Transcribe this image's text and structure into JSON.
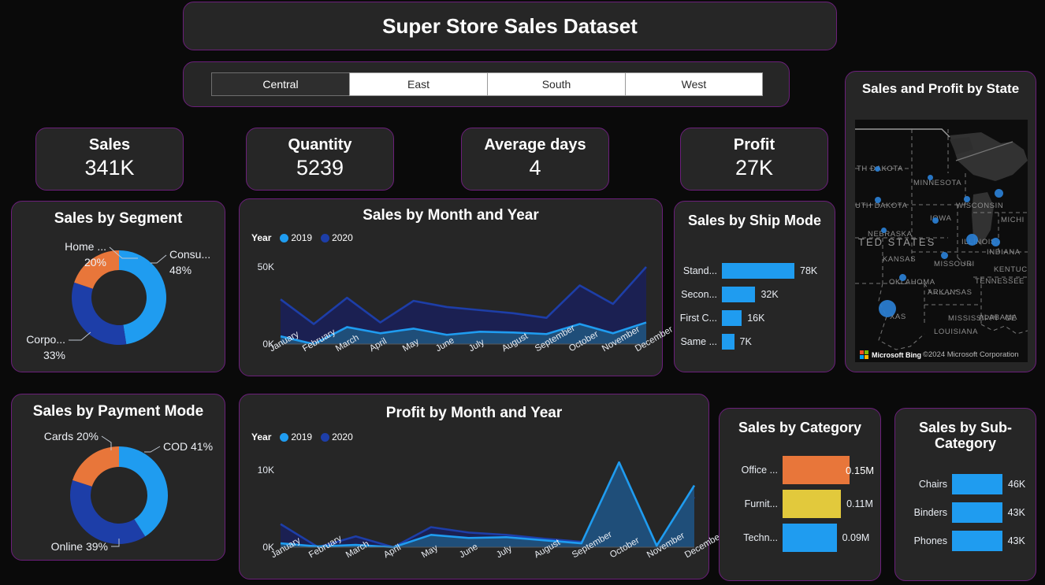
{
  "header": {
    "title": "Super Store Sales Dataset"
  },
  "slicer": {
    "name": "region-slicer",
    "options": [
      "Central",
      "East",
      "South",
      "West"
    ],
    "selected": "Central"
  },
  "kpis": [
    {
      "label": "Sales",
      "value": "341K"
    },
    {
      "label": "Quantity",
      "value": "5239"
    },
    {
      "label": "Average days",
      "value": "4"
    },
    {
      "label": "Profit",
      "value": "27K"
    }
  ],
  "colors": {
    "card_bg": "#262626",
    "card_border": "#6b1f7a",
    "page_bg": "#0a0a0a",
    "light_blue": "#1f9cf0",
    "dark_blue": "#1d3ea8",
    "orange": "#e8763a",
    "yellow": "#e2c93c",
    "area_2019_fill": "#1f4e79",
    "area_2020_fill": "#1b2052",
    "map_bubble": "#2a7fd4"
  },
  "panels": {
    "segment": {
      "title": "Sales by Segment"
    },
    "sales_month": {
      "title": "Sales by Month and Year"
    },
    "ship_mode": {
      "title": "Sales by Ship Mode"
    },
    "map": {
      "title": "Sales and Profit by State"
    },
    "payment": {
      "title": "Sales by Payment Mode"
    },
    "profit_month": {
      "title": "Profit by Month and Year"
    },
    "category": {
      "title": "Sales by Category"
    },
    "subcategory": {
      "title": "Sales by Sub-Category"
    }
  },
  "map": {
    "attribution": "Microsoft Bing",
    "copyright": "©2024 Microsoft Corporation",
    "state_labels": [
      "TH DAKOTA",
      "MINNESOTA",
      "WISCONSIN",
      "MICHI",
      "UTH DAKOTA",
      "IOWA",
      "NEBRASKA",
      "ILLINOIS",
      "INDIANA",
      "TED STATES",
      "KANSAS",
      "MISSOURI",
      "KENTUC",
      "OKLAHOMA",
      "ARKANSAS",
      "TENNESSEE",
      "ALABAMA",
      "XAS",
      "MISSISSIPPI",
      "LOUISIANA",
      "GE"
    ]
  },
  "chart_data": [
    {
      "id": "segment_donut",
      "type": "pie",
      "title": "Sales by Segment",
      "categories": [
        "Consu...",
        "Corpo...",
        "Home ..."
      ],
      "values": [
        48,
        33,
        20
      ],
      "value_labels": [
        "48%",
        "33%",
        "20%"
      ],
      "colors": [
        "#1f9cf0",
        "#1d3ea8",
        "#e8763a"
      ],
      "legend": "off"
    },
    {
      "id": "sales_by_month_year",
      "type": "area",
      "title": "Sales by Month and Year",
      "legend_title": "Year",
      "categories": [
        "January",
        "February",
        "March",
        "April",
        "May",
        "June",
        "July",
        "August",
        "September",
        "October",
        "November",
        "December"
      ],
      "series": [
        {
          "name": "2019",
          "color": "#1f9cf0",
          "values": [
            5000,
            0,
            11000,
            7000,
            10000,
            6000,
            8000,
            7500,
            6500,
            13000,
            7000,
            14000
          ]
        },
        {
          "name": "2020",
          "color": "#1d3ea8",
          "values": [
            29000,
            13000,
            30000,
            14000,
            28000,
            24000,
            22000,
            20000,
            17000,
            38000,
            26000,
            50000
          ]
        }
      ],
      "ylim": [
        0,
        50000
      ],
      "ytick_labels": [
        "0K",
        "50K"
      ],
      "xlabel": "",
      "ylabel": "",
      "grid": false
    },
    {
      "id": "sales_by_ship_mode",
      "type": "bar",
      "orientation": "horizontal",
      "title": "Sales by Ship Mode",
      "categories": [
        "Stand...",
        "Secon...",
        "First C...",
        "Same ..."
      ],
      "values": [
        78,
        32,
        16,
        7
      ],
      "value_labels": [
        "78K",
        "32K",
        "16K",
        "7K"
      ],
      "color": "#1f9cf0"
    },
    {
      "id": "payment_donut",
      "type": "pie",
      "title": "Sales by Payment Mode",
      "categories": [
        "COD",
        "Online",
        "Cards"
      ],
      "values": [
        41,
        39,
        20
      ],
      "value_labels": [
        "COD 41%",
        "Online 39%",
        "Cards 20%"
      ],
      "colors": [
        "#1f9cf0",
        "#1d3ea8",
        "#e8763a"
      ],
      "legend": "off"
    },
    {
      "id": "profit_by_month_year",
      "type": "area",
      "title": "Profit by Month and Year",
      "legend_title": "Year",
      "categories": [
        "January",
        "February",
        "March",
        "April",
        "May",
        "June",
        "July",
        "August",
        "September",
        "October",
        "November",
        "December"
      ],
      "series": [
        {
          "name": "2019",
          "color": "#1f9cf0",
          "values": [
            500,
            100,
            300,
            -400,
            1600,
            1200,
            1300,
            900,
            500,
            11000,
            200,
            8000
          ]
        },
        {
          "name": "2020",
          "color": "#1d3ea8",
          "values": [
            3000,
            -500,
            1400,
            -300,
            2600,
            1900,
            1600,
            1100,
            700,
            700,
            300,
            6500
          ]
        }
      ],
      "ylim": [
        0,
        10000
      ],
      "ytick_labels": [
        "0K",
        "10K"
      ],
      "xlabel": "",
      "ylabel": "",
      "grid": false
    },
    {
      "id": "sales_by_category",
      "type": "bar",
      "orientation": "horizontal",
      "title": "Sales by Category",
      "categories": [
        "Office ...",
        "Furnit...",
        "Techn..."
      ],
      "values": [
        0.15,
        0.11,
        0.09
      ],
      "value_labels": [
        "0.15M",
        "0.11M",
        "0.09M"
      ],
      "colors": [
        "#e8763a",
        "#e2c93c",
        "#1f9cf0"
      ]
    },
    {
      "id": "sales_by_subcategory",
      "type": "bar",
      "orientation": "horizontal",
      "title": "Sales by Sub-Category",
      "categories": [
        "Chairs",
        "Binders",
        "Phones"
      ],
      "values": [
        46,
        43,
        43
      ],
      "value_labels": [
        "46K",
        "43K",
        "43K"
      ],
      "color": "#1f9cf0"
    }
  ]
}
